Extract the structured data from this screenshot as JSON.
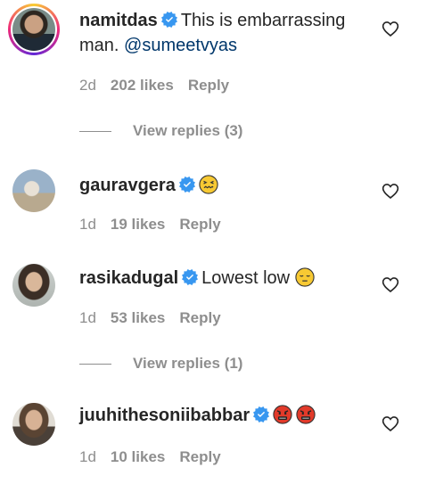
{
  "comments": [
    {
      "username": "namitdas",
      "text": "This is embarrassing",
      "text_line2_prefix": "man. ",
      "mention": "@sumeetvyas",
      "age": "2d",
      "likes": "202 likes",
      "reply_label": "Reply",
      "view_replies": "View replies (3)"
    },
    {
      "username": "gauravgera",
      "emoji": "😖",
      "age": "1d",
      "likes": "19 likes",
      "reply_label": "Reply"
    },
    {
      "username": "rasikadugal",
      "text": "Lowest low",
      "emoji": "😔",
      "age": "1d",
      "likes": "53 likes",
      "reply_label": "Reply",
      "view_replies": "View replies (1)"
    },
    {
      "username": "juuhithesoniibabbar",
      "emoji": "🤬🤬",
      "age": "1d",
      "likes": "10 likes",
      "reply_label": "Reply"
    }
  ],
  "colors": {
    "verified_blue": "#3897f0",
    "meta_gray": "#8e8e8e",
    "mention_blue": "#00376b"
  },
  "icons": {
    "like": "heart-outline-icon",
    "verified": "verified-badge-icon"
  }
}
